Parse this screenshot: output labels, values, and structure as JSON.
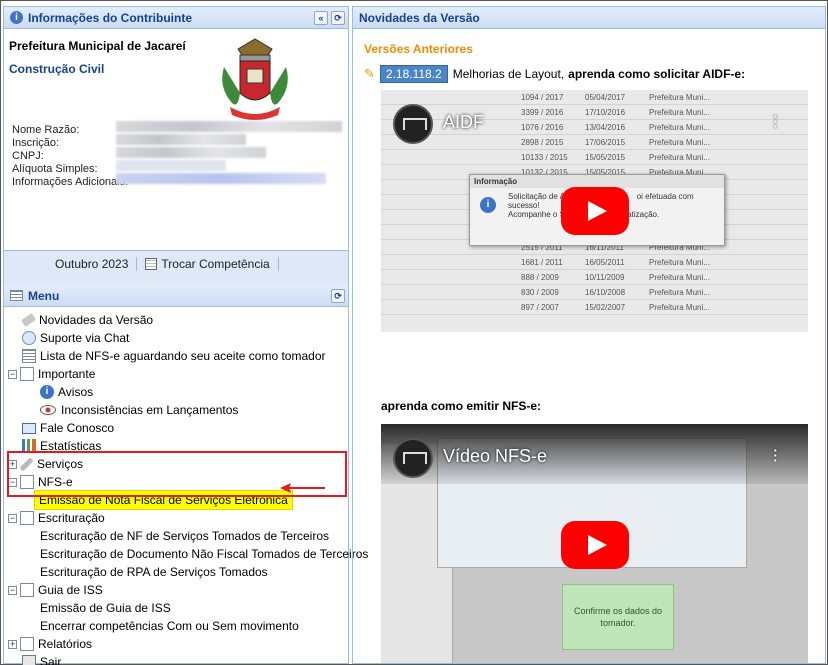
{
  "contributor": {
    "header": "Informações do Contribuinte",
    "city": "Prefeitura Municipal de Jacareí",
    "sector": "Construção Civil",
    "field_labels": [
      "Nome Razão:",
      "Inscrição:",
      "CNPJ:",
      "Alíquota Simples:",
      "Informações Adicionais:"
    ],
    "period": "Outubro 2023",
    "change_period": "Trocar Competência"
  },
  "menu": {
    "header": "Menu",
    "items": [
      {
        "label": "Novidades da Versão"
      },
      {
        "label": "Suporte via Chat"
      },
      {
        "label": "Lista de NFS-e aguardando seu aceite como tomador"
      },
      {
        "label": "Importante"
      },
      {
        "label": "Avisos"
      },
      {
        "label": "Inconsistências em Lançamentos"
      },
      {
        "label": "Fale Conosco"
      },
      {
        "label": "Estatísticas"
      },
      {
        "label": "Serviços"
      },
      {
        "label": "NFS-e"
      },
      {
        "label": "Emissão de Nota Fiscal de Serviços Eletrônica"
      },
      {
        "label": "Escrituração"
      },
      {
        "label": "Escrituração de NF de Serviços Tomados de Terceiros"
      },
      {
        "label": "Escrituração de Documento Não Fiscal Tomados de Terceiros"
      },
      {
        "label": "Escrituração de RPA de Serviços Tomados"
      },
      {
        "label": "Guia de ISS"
      },
      {
        "label": "Emissão de Guia de ISS"
      },
      {
        "label": "Encerrar competências Com ou Sem movimento"
      },
      {
        "label": "Relatórios"
      },
      {
        "label": "Sair"
      }
    ]
  },
  "news": {
    "header": "Novidades da Versão",
    "previous_versions": "Versões Anteriores",
    "version_badge": "2.18.118.2",
    "version_text": "Melhorias de Layout,",
    "version_link": "aprenda como solicitar AIDF-e:",
    "video1_title": "AIDF",
    "dialog_title": "Informação",
    "dialog_msg1": "Solicitação de A",
    "dialog_msg2": "oi efetuada com",
    "dialog_msg3": "sucesso!",
    "dialog_msg4": "Acompanhe o S",
    "dialog_msg5": "atização.",
    "caption2": "aprenda como emitir NFS-e:",
    "video2_title": "Vídeo NFS-e",
    "video2_green": "Confirme os dados do tomador.",
    "video1_rows": [
      [
        "1094 / 2017",
        "05/04/2017",
        "Prefeitura Muni..."
      ],
      [
        "3399 / 2016",
        "17/10/2016",
        "Prefeitura Muni..."
      ],
      [
        "1076 / 2016",
        "13/04/2016",
        "Prefeitura Muni..."
      ],
      [
        "2898 / 2015",
        "17/06/2015",
        "Prefeitura Muni..."
      ],
      [
        "10133 / 2015",
        "15/05/2015",
        "Prefeitura Muni..."
      ],
      [
        "10132 / 2015",
        "15/05/2015",
        "Prefeitura Muni..."
      ],
      [
        "",
        "",
        ""
      ],
      [
        "",
        "",
        ""
      ],
      [
        "",
        "",
        ""
      ],
      [
        "",
        "",
        ""
      ],
      [
        "2515 / 2011",
        "16/11/2011",
        "Prefeitura Muni..."
      ],
      [
        "1681 / 2011",
        "16/05/2011",
        "Prefeitura Muni..."
      ],
      [
        "888 / 2009",
        "10/11/2009",
        "Prefeitura Muni..."
      ],
      [
        "830 / 2009",
        "16/10/2008",
        "Prefeitura Muni..."
      ],
      [
        "897 / 2007",
        "15/02/2007",
        "Prefeitura Muni..."
      ]
    ]
  }
}
